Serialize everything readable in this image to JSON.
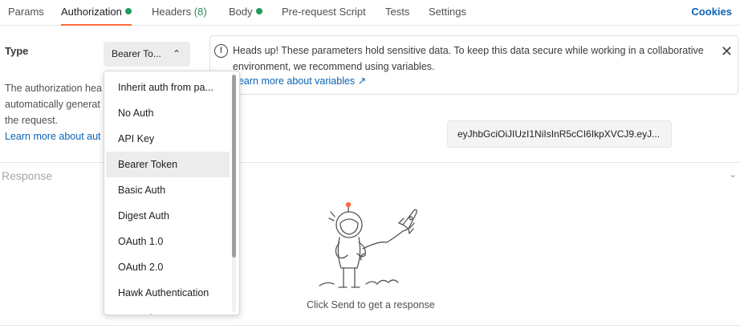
{
  "tabs": [
    {
      "label": "Params"
    },
    {
      "label": "Authorization",
      "dot": true,
      "active": true
    },
    {
      "label": "Headers",
      "count": "(8)"
    },
    {
      "label": "Body",
      "dot": true
    },
    {
      "label": "Pre-request Script"
    },
    {
      "label": "Tests"
    },
    {
      "label": "Settings"
    }
  ],
  "cookies_label": "Cookies",
  "auth": {
    "type_label": "Type",
    "selected_type": "Bearer To...",
    "description_lines": [
      "The authorization hea",
      "automatically generat",
      "the request."
    ],
    "learn_more": "Learn more about aut"
  },
  "banner": {
    "text": "Heads up! These parameters hold sensitive data. To keep this data secure while working in a collaborative environment, we recommend using variables.",
    "link": "Learn more about variables ↗"
  },
  "token_value": "eyJhbGciOiJIUzI1NiIsInR5cCI6IkpXVCJ9.eyJ...",
  "response": {
    "label": "Response",
    "empty_message": "Click Send to get a response"
  },
  "dropdown_items": [
    "Inherit auth from pa...",
    "No Auth",
    "API Key",
    "Bearer Token",
    "Basic Auth",
    "Digest Auth",
    "OAuth 1.0",
    "OAuth 2.0",
    "Hawk Authentication",
    "AWS Si..."
  ],
  "dropdown_selected": "Bearer Token",
  "colors": {
    "accent": "#ff6c37",
    "link": "#0b63b6",
    "status_dot": "#1e9e5a"
  }
}
